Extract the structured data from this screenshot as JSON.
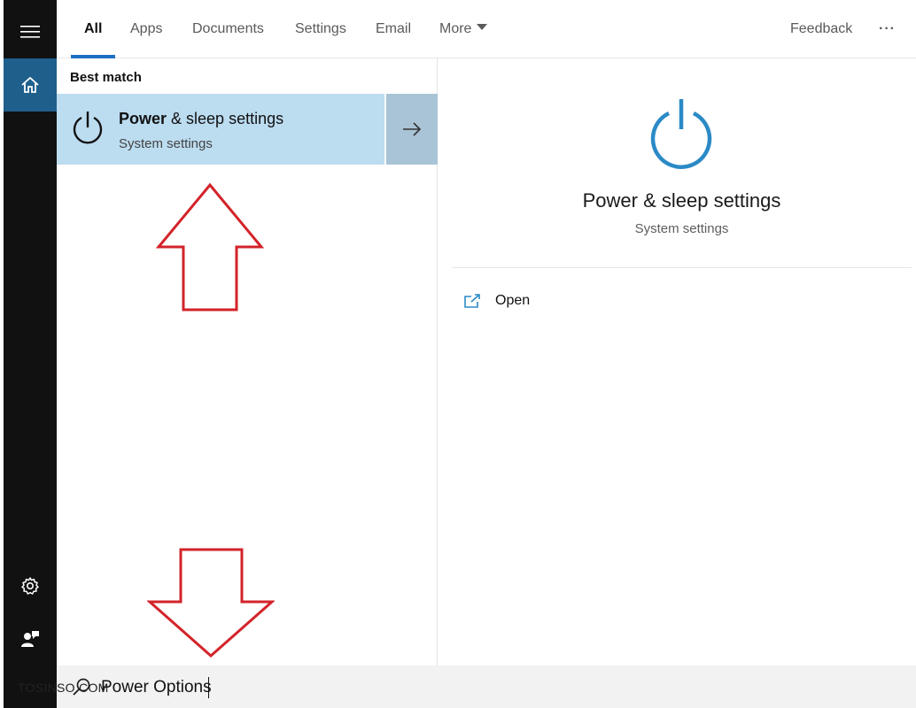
{
  "rail": {
    "menu_icon": "hamburger-icon",
    "home_icon": "home-icon",
    "settings_icon": "gear-icon",
    "user_icon": "user-feedback-icon"
  },
  "topbar": {
    "tabs": [
      "All",
      "Apps",
      "Documents",
      "Settings",
      "Email",
      "More"
    ],
    "active_tab": "All",
    "feedback_label": "Feedback",
    "overflow_label": "···"
  },
  "results": {
    "section_header": "Best match",
    "best_match": {
      "title_bold": "Power",
      "title_rest": " & sleep settings",
      "subtitle": "System settings"
    }
  },
  "preview": {
    "title": "Power & sleep settings",
    "subtitle": "System settings",
    "actions": [
      {
        "label": "Open"
      }
    ]
  },
  "search": {
    "value": "Power Options"
  },
  "watermark": "TOSINSO.COM",
  "colors": {
    "rail_bg": "#111111",
    "rail_active": "#1e5f8c",
    "accent_blue": "#2b8ac6",
    "selected_bg": "#bcdcf0",
    "annotation_red": "#d3232a"
  }
}
